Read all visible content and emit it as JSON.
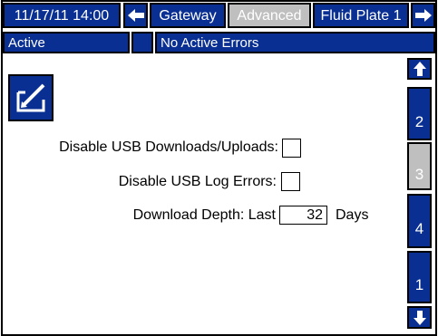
{
  "header": {
    "datetime": "11/17/11 14:00",
    "tabs": [
      {
        "label": "Gateway"
      },
      {
        "label": "Advanced"
      },
      {
        "label": "Fluid Plate 1"
      }
    ]
  },
  "status": {
    "state": "Active",
    "errors": "No Active Errors"
  },
  "settings": {
    "usb_downloads_label": "Disable USB Downloads/Uploads:",
    "usb_log_errors_label": "Disable USB Log Errors:",
    "download_depth_label": "Download Depth: Last",
    "download_depth_value": "32",
    "download_depth_unit": "Days"
  },
  "side_tabs": [
    {
      "label": "2"
    },
    {
      "label": "3"
    },
    {
      "label": "4"
    },
    {
      "label": "1"
    }
  ],
  "colors": {
    "panel_blue": "#0a2f93",
    "inactive_grey": "#bfbfbf"
  }
}
